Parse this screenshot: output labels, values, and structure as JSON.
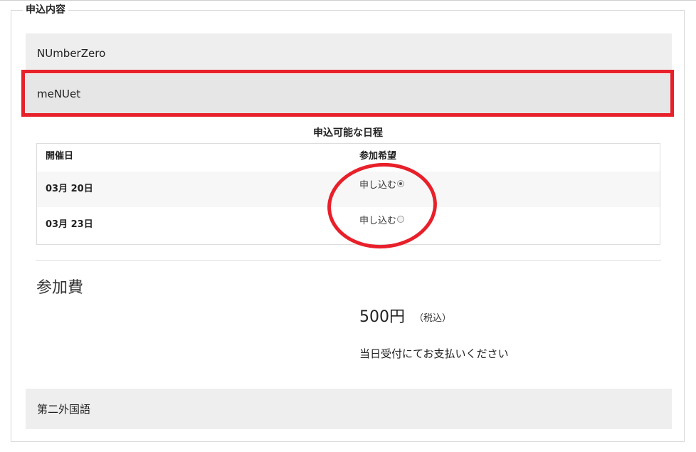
{
  "section": {
    "legend": "申込内容"
  },
  "courses": [
    {
      "label": "NUmberZero"
    },
    {
      "label": "meNUet"
    },
    {
      "label": "第二外国語"
    }
  ],
  "schedule": {
    "title": "申込可能な日程",
    "headers": {
      "date": "開催日",
      "wish": "参加希望"
    },
    "rows": [
      {
        "date": "03月 20日",
        "apply_label": "申し込む",
        "selected": true
      },
      {
        "date": "03月 23日",
        "apply_label": "申し込む",
        "selected": false
      }
    ]
  },
  "fee": {
    "label": "参加費",
    "amount": "500円",
    "tax": "（税込）",
    "note": "当日受付にてお支払いください"
  },
  "annotations": {
    "color": "#e8202a"
  }
}
